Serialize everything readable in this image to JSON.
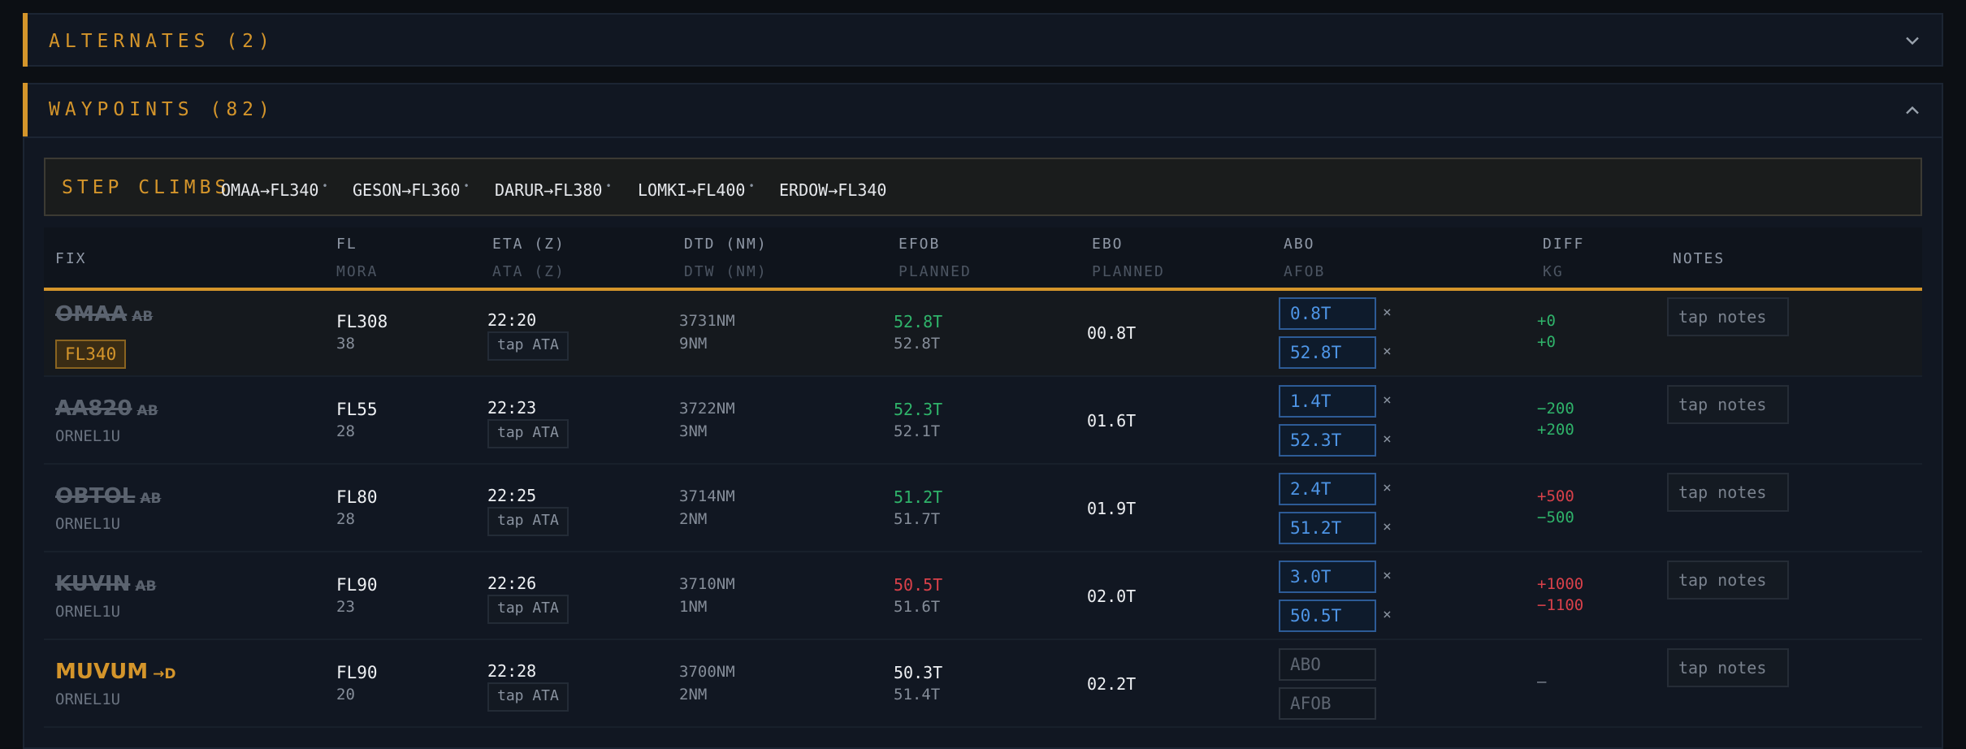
{
  "alternates": {
    "title": "ALTERNATES (2)"
  },
  "waypoints": {
    "title": "WAYPOINTS (82)"
  },
  "step_climbs": {
    "label": "STEP CLIMBS",
    "items": [
      "OMAA→FL340",
      "GESON→FL360",
      "DARUR→FL380",
      "LOMKI→FL400",
      "ERDOW→FL340"
    ]
  },
  "headers": {
    "fix": "FIX",
    "fl": "FL",
    "mora": "MORA",
    "eta": "ETA (Z)",
    "ata": "ATA (Z)",
    "dtd": "DTD (NM)",
    "dtw": "DTW (NM)",
    "efob": "EFOB",
    "efob_planned": "PLANNED",
    "ebo": "EBO",
    "ebo_planned": "PLANNED",
    "abo": "ABO",
    "afob": "AFOB",
    "diff": "DIFF",
    "kg": "KG",
    "notes": "NOTES"
  },
  "rows": [
    {
      "fix": "OMAA",
      "tag": "AB",
      "sub": "",
      "badge": "FL340",
      "fl": "FL308",
      "mora": "38",
      "eta": "22:20",
      "ata_btn": "tap ATA",
      "dtd": "3731NM",
      "dtw": "9NM",
      "efob": "52.8T",
      "efob_planned": "52.8T",
      "efob_color": "green",
      "ebo": "00.8T",
      "abo": "0.8T",
      "afob": "52.8T",
      "x1": "×",
      "x2": "×",
      "diff1": "+0",
      "diff2": "+0",
      "diff1_color": "green",
      "diff2_color": "green",
      "notes": "tap notes"
    },
    {
      "fix": "AA820",
      "tag": "AB",
      "sub": "ORNEL1U",
      "fl": "FL55",
      "mora": "28",
      "eta": "22:23",
      "ata_btn": "tap ATA",
      "dtd": "3722NM",
      "dtw": "3NM",
      "efob": "52.3T",
      "efob_planned": "52.1T",
      "efob_color": "green",
      "ebo": "01.6T",
      "abo": "1.4T",
      "afob": "52.3T",
      "x1": "×",
      "x2": "×",
      "diff1": "−200",
      "diff2": "+200",
      "diff1_color": "green",
      "diff2_color": "green",
      "notes": "tap notes"
    },
    {
      "fix": "OBTOL",
      "tag": "AB",
      "sub": "ORNEL1U",
      "fl": "FL80",
      "mora": "28",
      "eta": "22:25",
      "ata_btn": "tap ATA",
      "dtd": "3714NM",
      "dtw": "2NM",
      "efob": "51.2T",
      "efob_planned": "51.7T",
      "efob_color": "green",
      "ebo": "01.9T",
      "abo": "2.4T",
      "afob": "51.2T",
      "x1": "×",
      "x2": "×",
      "diff1": "+500",
      "diff2": "−500",
      "diff1_color": "red",
      "diff2_color": "green",
      "notes": "tap notes"
    },
    {
      "fix": "KUVIN",
      "tag": "AB",
      "sub": "ORNEL1U",
      "fl": "FL90",
      "mora": "23",
      "eta": "22:26",
      "ata_btn": "tap ATA",
      "dtd": "3710NM",
      "dtw": "1NM",
      "efob": "50.5T",
      "efob_planned": "51.6T",
      "efob_color": "red",
      "ebo": "02.0T",
      "abo": "3.0T",
      "afob": "50.5T",
      "x1": "×",
      "x2": "×",
      "diff1": "+1000",
      "diff2": "−1100",
      "diff1_color": "red",
      "diff2_color": "red",
      "notes": "tap notes"
    },
    {
      "fix": "MUVUM",
      "tag": "→D",
      "sub": "ORNEL1U",
      "active": true,
      "fl": "FL90",
      "mora": "20",
      "eta": "22:28",
      "ata_btn": "tap ATA",
      "dtd": "3700NM",
      "dtw": "2NM",
      "efob": "50.3T",
      "efob_planned": "51.4T",
      "efob_color": "white",
      "ebo": "02.2T",
      "abo_placeholder": "ABO",
      "afob_placeholder": "AFOB",
      "diff_single": "—",
      "notes": "tap notes"
    }
  ],
  "colors": {
    "accent": "#d4952b",
    "green": "#2fb36a",
    "red": "#d9414a",
    "input_blue": "#4e95e6",
    "background": "#0c0f14"
  }
}
